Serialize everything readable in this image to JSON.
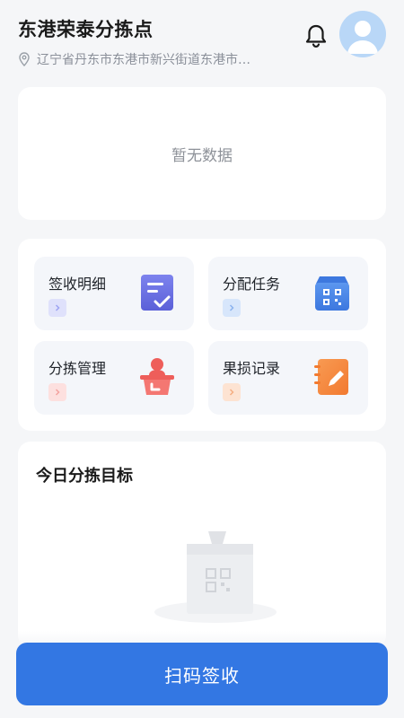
{
  "header": {
    "title": "东港荣泰分拣点",
    "address": "辽宁省丹东市东港市新兴街道东港市…"
  },
  "summary_card": {
    "empty_text": "暂无数据"
  },
  "menu": {
    "items": [
      {
        "label": "签收明细",
        "icon": "sign-receipt-icon",
        "color": "#6a70e6"
      },
      {
        "label": "分配任务",
        "icon": "assign-task-icon",
        "color": "#4a86e8"
      },
      {
        "label": "分拣管理",
        "icon": "sorting-manage-icon",
        "color": "#f06a66"
      },
      {
        "label": "果损记录",
        "icon": "fruit-damage-record-icon",
        "color": "#f5883f"
      }
    ]
  },
  "target_card": {
    "title": "今日分拣目标"
  },
  "scan_button": {
    "label": "扫码签收",
    "color": "#3377e3"
  }
}
